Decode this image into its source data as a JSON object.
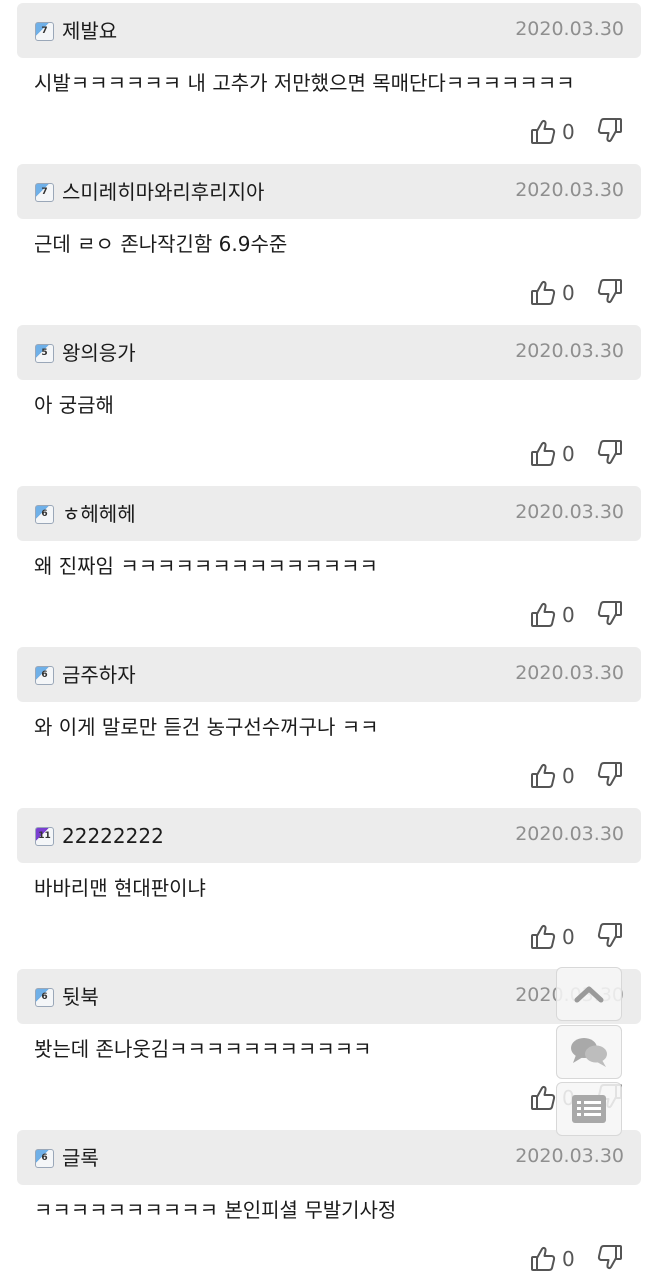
{
  "comments": [
    {
      "level": "7",
      "nickname": "제발요",
      "date": "2020.03.30",
      "text": "시발ㅋㅋㅋㅋㅋㅋ 내 고추가 저만했으면 목매단다ㅋㅋㅋㅋㅋㅋㅋ",
      "likes": "0"
    },
    {
      "level": "7",
      "nickname": "스미레히마와리후리지아",
      "date": "2020.03.30",
      "text": "근데 ㄹㅇ 존나작긴함 6.9수준",
      "likes": "0"
    },
    {
      "level": "5",
      "nickname": "왕의응가",
      "date": "2020.03.30",
      "text": "아 궁금해",
      "likes": "0"
    },
    {
      "level": "6",
      "nickname": "ㅎ헤헤헤",
      "date": "2020.03.30",
      "text": "왜 진짜임 ㅋㅋㅋㅋㅋㅋㅋㅋㅋㅋㅋㅋㅋㅋ",
      "likes": "0"
    },
    {
      "level": "6",
      "nickname": "금주하자",
      "date": "2020.03.30",
      "text": "와 이게 말로만 듣건 농구선수꺼구나 ㅋㅋ",
      "likes": "0"
    },
    {
      "level": "11",
      "nickname": "22222222",
      "date": "2020.03.30",
      "text": "바바리맨 현대판이냐",
      "likes": "0"
    },
    {
      "level": "6",
      "nickname": "뒷북",
      "date": "2020.03.30",
      "text": "봣는데 존나웃김ㅋㅋㅋㅋㅋㅋㅋㅋㅋㅋㅋ",
      "likes": "0"
    },
    {
      "level": "6",
      "nickname": "글록",
      "date": "2020.03.30",
      "text": "ㅋㅋㅋㅋㅋㅋㅋㅋㅋㅋ 본인피셜 무발기사정",
      "likes": "0"
    }
  ],
  "floating_buttons": {
    "scroll_top": "chevron-up-icon",
    "comments": "chat-bubbles-icon",
    "list": "list-icon"
  }
}
